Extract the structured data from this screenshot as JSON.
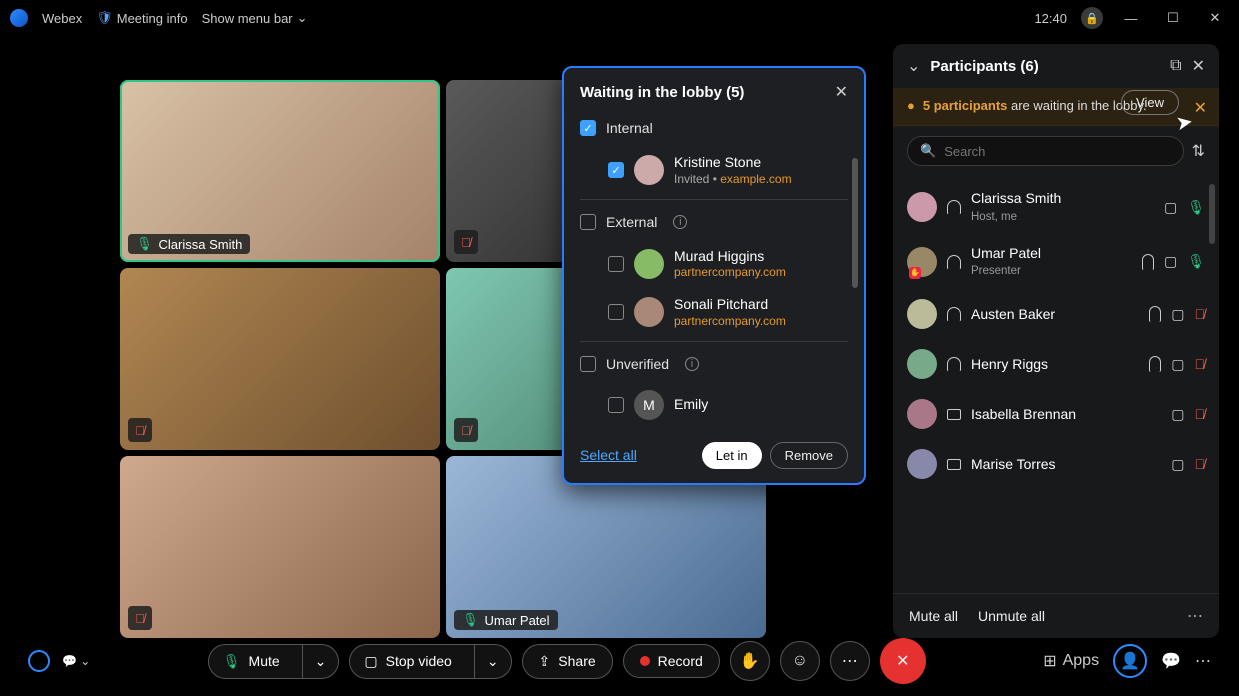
{
  "titlebar": {
    "app": "Webex",
    "meeting_info": "Meeting info",
    "show_menu": "Show menu bar",
    "clock": "12:40"
  },
  "tiles": [
    {
      "name": "Clarissa Smith",
      "mic": "on",
      "active": true
    },
    {
      "name": "",
      "mic": "off",
      "active": false
    },
    {
      "name": "",
      "mic": "off",
      "active": false
    },
    {
      "name": "",
      "mic": "off",
      "active": false
    },
    {
      "name": "",
      "mic": "off",
      "active": false
    },
    {
      "name": "Umar Patel",
      "mic": "on",
      "active": false
    }
  ],
  "lobby": {
    "title": "Waiting in the lobby (5)",
    "groups": {
      "internal": "Internal",
      "external": "External",
      "unverified": "Unverified"
    },
    "items": {
      "kristine": {
        "name": "Kristine Stone",
        "sub_prefix": "Invited • ",
        "sub_domain": "example.com"
      },
      "murad": {
        "name": "Murad Higgins",
        "sub": "partnercompany.com"
      },
      "sonali": {
        "name": "Sonali Pitchard",
        "sub": "partnercompany.com"
      },
      "emily": {
        "name": "Emily",
        "initial": "M"
      }
    },
    "select_all": "Select all",
    "let_in": "Let in",
    "remove": "Remove"
  },
  "panel": {
    "title": "Participants (6)",
    "banner_count": "5 participants",
    "banner_rest": " are waiting in the lobby.",
    "view": "View",
    "search_placeholder": "Search",
    "rows": [
      {
        "name": "Clarissa Smith",
        "sub": "Host, me",
        "headset": true,
        "hand": false,
        "cam": true,
        "mic": "on"
      },
      {
        "name": "Umar Patel",
        "sub": "Presenter",
        "headset": true,
        "hand": true,
        "raised": true,
        "cam": true,
        "mic": "on"
      },
      {
        "name": "Austen Baker",
        "sub": "",
        "headset": true,
        "hand": true,
        "cam": true,
        "mic": "off"
      },
      {
        "name": "Henry Riggs",
        "sub": "",
        "headset": true,
        "hand": true,
        "cam": true,
        "mic": "off"
      },
      {
        "name": "Isabella Brennan",
        "sub": "",
        "screen": true,
        "cam": true,
        "mic": "off"
      },
      {
        "name": "Marise Torres",
        "sub": "",
        "screen": true,
        "cam": true,
        "mic": "off"
      }
    ],
    "mute_all": "Mute all",
    "unmute_all": "Unmute all"
  },
  "controls": {
    "mute": "Mute",
    "stop_video": "Stop video",
    "share": "Share",
    "record": "Record",
    "apps": "Apps"
  }
}
